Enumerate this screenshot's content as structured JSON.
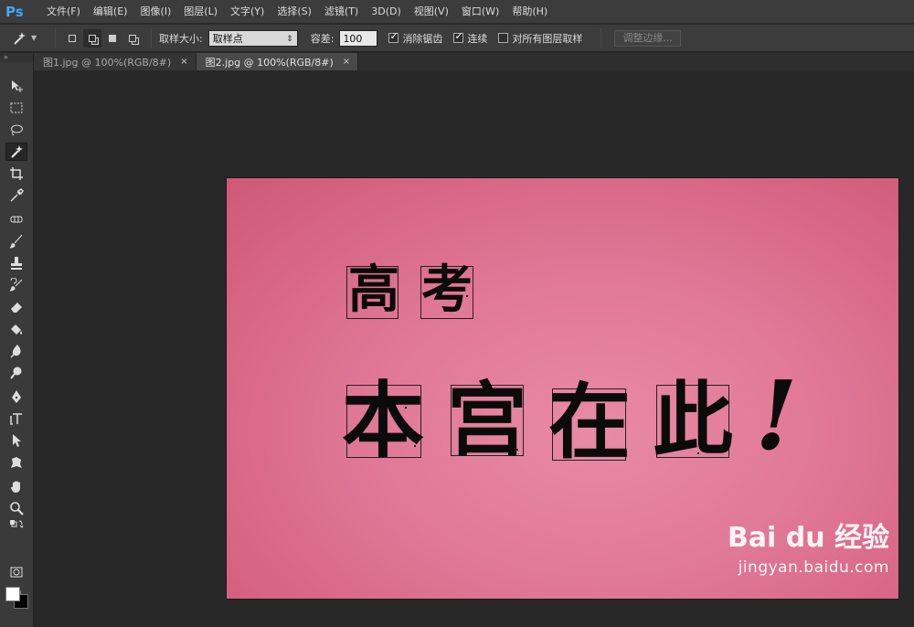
{
  "app": {
    "logo": "Ps"
  },
  "menu": [
    "文件(F)",
    "编辑(E)",
    "图像(I)",
    "图层(L)",
    "文字(Y)",
    "选择(S)",
    "滤镜(T)",
    "3D(D)",
    "视图(V)",
    "窗口(W)",
    "帮助(H)"
  ],
  "options": {
    "sample_size_label": "取样大小:",
    "sample_size_value": "取样点",
    "tolerance_label": "容差:",
    "tolerance_value": "100",
    "antialias_label": "消除锯齿",
    "antialias_checked": true,
    "contiguous_label": "连续",
    "contiguous_checked": true,
    "all_layers_label": "对所有图层取样",
    "all_layers_checked": false,
    "refine_edge_label": "调整边缘..."
  },
  "tabs": [
    {
      "label": "图1.jpg @ 100%(RGB/8#)",
      "close": "×",
      "active": false
    },
    {
      "label": "图2.jpg @ 100%(RGB/8#)",
      "close": "×",
      "active": true
    }
  ],
  "canvas": {
    "line1": [
      "高",
      "考"
    ],
    "line2": [
      "本",
      "宫",
      "在",
      "此",
      "!"
    ]
  },
  "watermark": {
    "brand": "Bai du 经验",
    "site": "jingyan.baidu.com"
  },
  "colors": {
    "foreground": "#ffffff",
    "background": "#000000",
    "accent": "#3fa7ff"
  }
}
